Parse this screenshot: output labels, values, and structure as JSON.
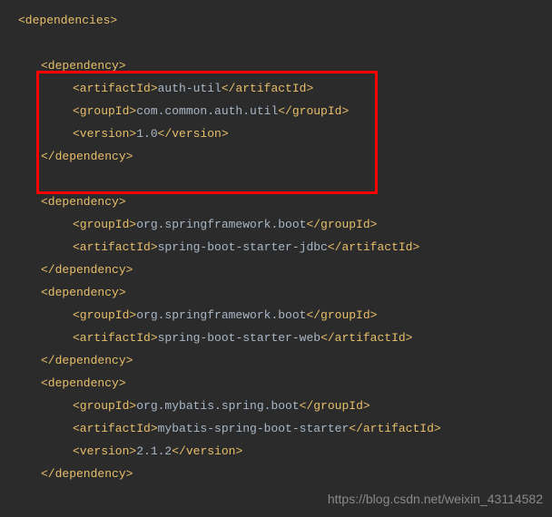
{
  "root": {
    "open": "<dependencies>"
  },
  "dep1": {
    "open": "<dependency>",
    "artifactId_open": "<artifactId>",
    "artifactId_val": "auth-util",
    "artifactId_close": "</artifactId>",
    "groupId_open": "<groupId>",
    "groupId_val": "com.common.auth.util",
    "groupId_close": "</groupId>",
    "version_open": "<version>",
    "version_val": "1.0",
    "version_close": "</version>",
    "close": "</dependency>"
  },
  "dep2": {
    "open": "<dependency>",
    "groupId_open": "<groupId>",
    "groupId_val": "org.springframework.boot",
    "groupId_close": "</groupId>",
    "artifactId_open": "<artifactId>",
    "artifactId_val": "spring-boot-starter-jdbc",
    "artifactId_close": "</artifactId>",
    "close": "</dependency>"
  },
  "dep3": {
    "open": "<dependency>",
    "groupId_open": "<groupId>",
    "groupId_val": "org.springframework.boot",
    "groupId_close": "</groupId>",
    "artifactId_open": "<artifactId>",
    "artifactId_val": "spring-boot-starter-web",
    "artifactId_close": "</artifactId>",
    "close": "</dependency>"
  },
  "dep4": {
    "open": "<dependency>",
    "groupId_open": "<groupId>",
    "groupId_val": "org.mybatis.spring.boot",
    "groupId_close": "</groupId>",
    "artifactId_open": "<artifactId>",
    "artifactId_val": "mybatis-spring-boot-starter",
    "artifactId_close": "</artifactId>",
    "version_open": "<version>",
    "version_val": "2.1.2",
    "version_close": "</version>",
    "close": "</dependency>"
  },
  "watermark": "https://blog.csdn.net/weixin_43114582"
}
